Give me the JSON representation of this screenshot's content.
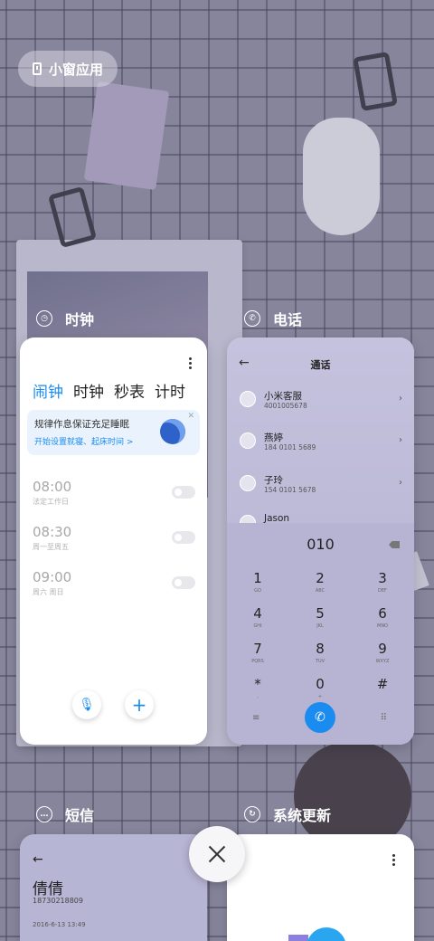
{
  "floating_window": {
    "label": "小窗应用"
  },
  "apps": {
    "clock": {
      "name": "时钟",
      "tabs": [
        "闹钟",
        "时钟",
        "秒表",
        "计时"
      ],
      "banner": {
        "title": "规律作息保证充足睡眠",
        "subtitle": "开始设置就寝、起床时间 >"
      },
      "alarms": [
        {
          "time": "08:00",
          "repeat": "法定工作日"
        },
        {
          "time": "08:30",
          "repeat": "周一至周五"
        },
        {
          "time": "09:00",
          "repeat": "周六 周日"
        }
      ]
    },
    "phone": {
      "name": "电话",
      "title": "通话",
      "contacts": [
        {
          "name": "小米客服",
          "number": "4001005678"
        },
        {
          "name": "燕婷",
          "number": "184 0101 5689"
        },
        {
          "name": "子玲",
          "number": "154 0101 5678"
        },
        {
          "name": "Jason",
          "number": ""
        }
      ],
      "dialed": "010",
      "keys": [
        {
          "n": "1",
          "s": "GO"
        },
        {
          "n": "2",
          "s": "ABC"
        },
        {
          "n": "3",
          "s": "DEF"
        },
        {
          "n": "4",
          "s": "GHI"
        },
        {
          "n": "5",
          "s": "JKL"
        },
        {
          "n": "6",
          "s": "MNO"
        },
        {
          "n": "7",
          "s": "PQRS"
        },
        {
          "n": "8",
          "s": "TUV"
        },
        {
          "n": "9",
          "s": "WXYZ"
        },
        {
          "n": "*",
          "s": ","
        },
        {
          "n": "0",
          "s": "+"
        },
        {
          "n": "#",
          "s": ""
        }
      ]
    },
    "sms": {
      "name": "短信",
      "contact_name": "倩倩",
      "contact_number": "18730218809",
      "date": "2016-6-13 13:49"
    },
    "update": {
      "name": "系统更新"
    }
  }
}
